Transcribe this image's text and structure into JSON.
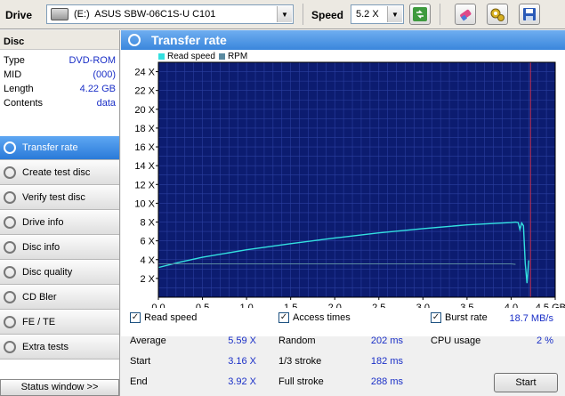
{
  "toolbar": {
    "drive_label": "Drive",
    "drive_letter": "(E:)",
    "drive_name": "ASUS SBW-06C1S-U C101",
    "speed_label": "Speed",
    "speed_value": "5.2 X",
    "icons": [
      "refresh-icon",
      "eraser-icon",
      "settings-icon",
      "save-icon"
    ]
  },
  "disc": {
    "title": "Disc",
    "rows": [
      {
        "label": "Type",
        "value": "DVD-ROM"
      },
      {
        "label": "MID",
        "value": "(000)"
      },
      {
        "label": "Length",
        "value": "4.22 GB"
      },
      {
        "label": "Contents",
        "value": "data"
      }
    ]
  },
  "nav": {
    "items": [
      {
        "label": "Transfer rate",
        "active": true
      },
      {
        "label": "Create test disc",
        "active": false
      },
      {
        "label": "Verify test disc",
        "active": false
      },
      {
        "label": "Drive info",
        "active": false
      },
      {
        "label": "Disc info",
        "active": false
      },
      {
        "label": "Disc quality",
        "active": false
      },
      {
        "label": "CD Bler",
        "active": false
      },
      {
        "label": "FE / TE",
        "active": false
      },
      {
        "label": "Extra tests",
        "active": false
      }
    ],
    "status_window": "Status window >>"
  },
  "main": {
    "title": "Transfer rate"
  },
  "chart_data": {
    "type": "line",
    "title": "",
    "xlabel": "",
    "ylabel": "",
    "xlim": [
      0,
      4.5
    ],
    "ylim": [
      0,
      25
    ],
    "x_ticks": [
      "0.0",
      "0.5",
      "1.0",
      "1.5",
      "2.0",
      "2.5",
      "3.0",
      "3.5",
      "4.0",
      "4.5 GB"
    ],
    "y_ticks": [
      "2 X",
      "4 X",
      "6 X",
      "8 X",
      "10 X",
      "12 X",
      "14 X",
      "16 X",
      "18 X",
      "20 X",
      "22 X",
      "24 X"
    ],
    "grid": true,
    "legend_position": "top-left",
    "colors": {
      "read_speed": "#33e0e0",
      "rpm": "#5a8aa0",
      "background": "#0c1c70",
      "grid": "#2b3fa0",
      "marker": "#c03050"
    },
    "marker_x": 4.22,
    "series": [
      {
        "name": "Read speed",
        "x": [
          0.0,
          0.25,
          0.5,
          1.0,
          1.5,
          2.0,
          2.5,
          3.0,
          3.5,
          4.0,
          4.05,
          4.08,
          4.1,
          4.12,
          4.14,
          4.16,
          4.18,
          4.2
        ],
        "y": [
          3.16,
          3.75,
          4.25,
          5.05,
          5.7,
          6.3,
          6.85,
          7.3,
          7.7,
          7.95,
          8.0,
          7.95,
          7.2,
          7.9,
          7.6,
          3.6,
          1.5,
          3.92
        ]
      },
      {
        "name": "RPM",
        "x": [
          0.0,
          0.5,
          1.0,
          2.0,
          3.0,
          3.8,
          4.0,
          4.05
        ],
        "y": [
          3.55,
          3.55,
          3.55,
          3.55,
          3.55,
          3.55,
          3.55,
          3.5
        ]
      }
    ]
  },
  "stats": {
    "read_speed": {
      "checkbox_label": "Read speed",
      "checked": "✓",
      "rows": [
        {
          "label": "Average",
          "value": "5.59 X"
        },
        {
          "label": "Start",
          "value": "3.16 X"
        },
        {
          "label": "End",
          "value": "3.92 X"
        }
      ]
    },
    "access_times": {
      "checkbox_label": "Access times",
      "checked": "✓",
      "rows": [
        {
          "label": "Random",
          "value": "202 ms"
        },
        {
          "label": "1/3 stroke",
          "value": "182 ms"
        },
        {
          "label": "Full stroke",
          "value": "288 ms"
        }
      ]
    },
    "burst_rate": {
      "checkbox_label": "Burst rate",
      "checked": "✓",
      "value": "18.7 MB/s"
    },
    "cpu_usage": {
      "label": "CPU usage",
      "value": "2 %"
    },
    "start_button": "Start"
  }
}
